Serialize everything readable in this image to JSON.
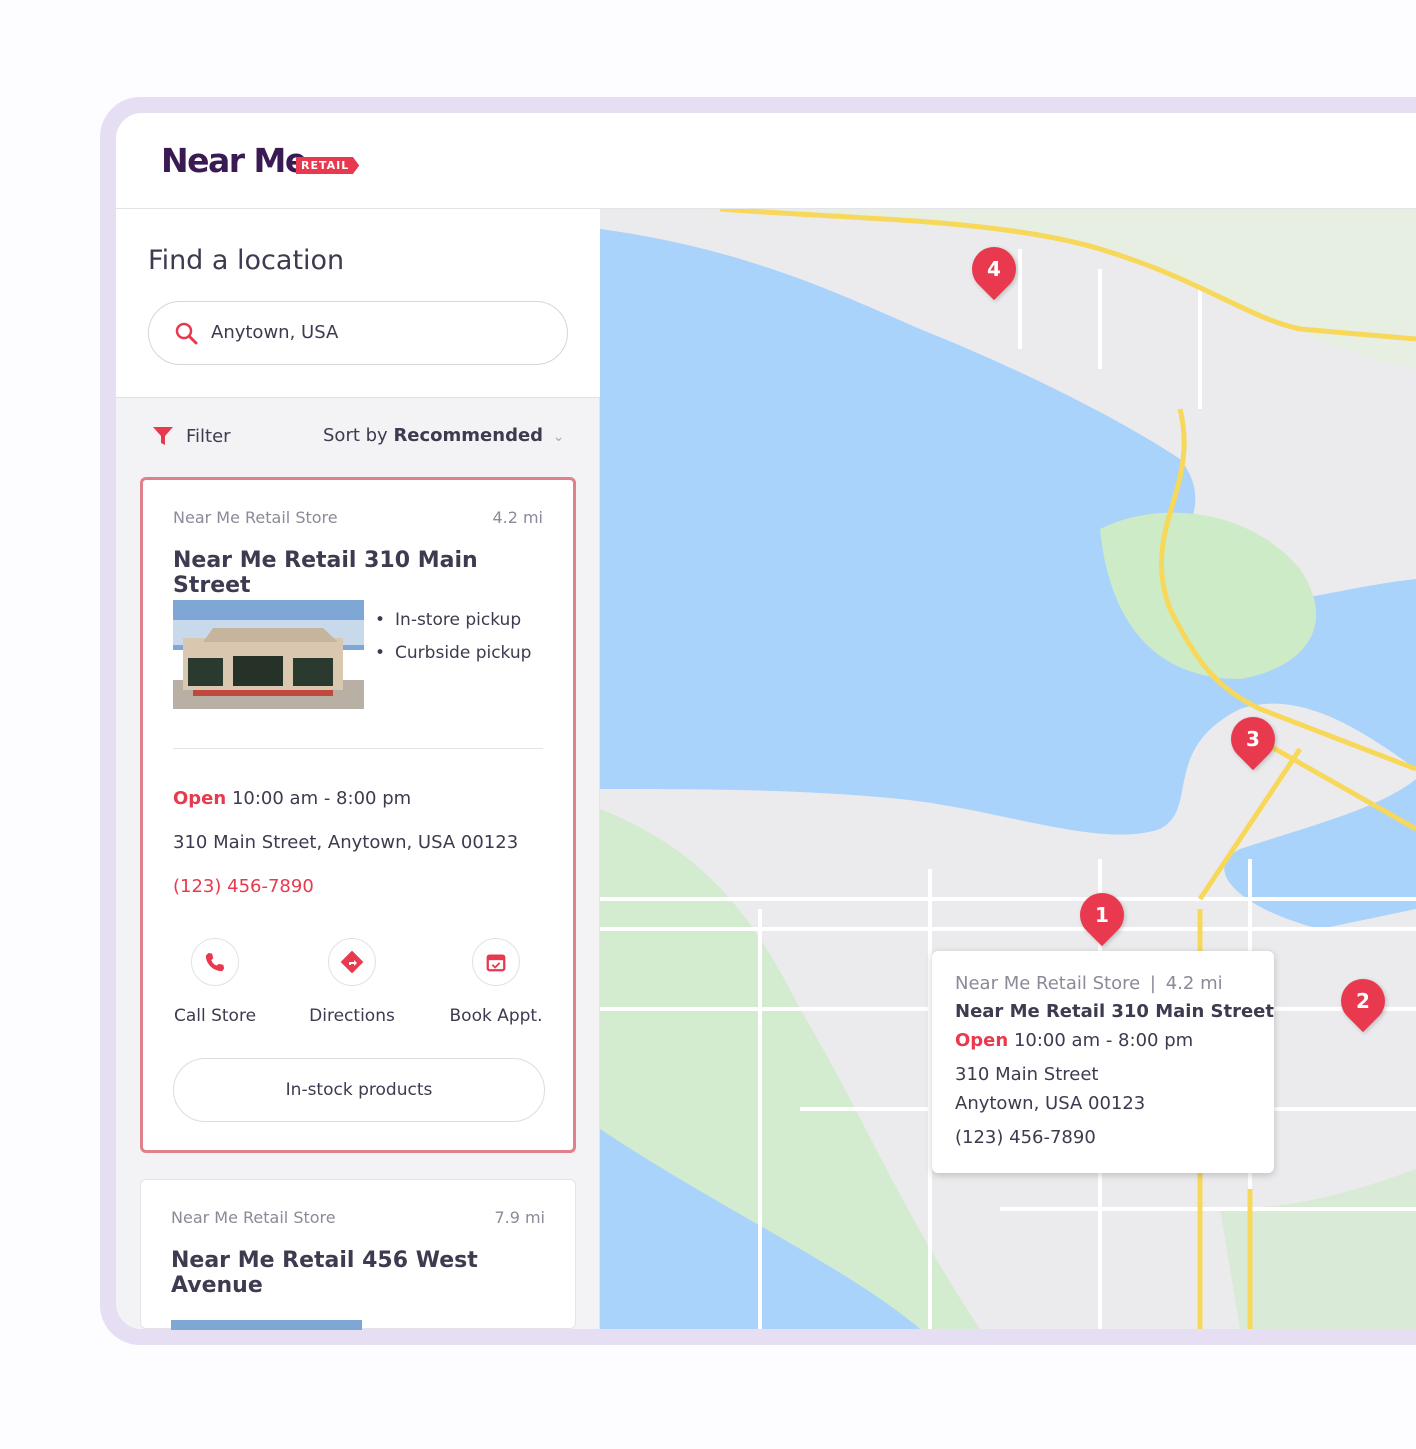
{
  "brand": {
    "name": "Near Me",
    "badge": "RETAIL",
    "accent": "#e8394e",
    "primary": "#3a1a52"
  },
  "search": {
    "title": "Find a location",
    "value": "Anytown, USA",
    "icon": "search-icon"
  },
  "toolbar": {
    "filter_label": "Filter",
    "sort_prefix": "Sort by",
    "sort_value": "Recommended"
  },
  "stores": [
    {
      "category": "Near Me Retail Store",
      "distance": "4.2 mi",
      "name": "Near Me Retail 310 Main Street",
      "features": [
        "In-store pickup",
        "Curbside pickup"
      ],
      "status": "Open",
      "hours": "10:00 am - 8:00 pm",
      "address": "310 Main Street, Anytown, USA 00123",
      "phone": "(123) 456-7890",
      "actions": [
        "Call Store",
        "Directions",
        "Book Appt."
      ],
      "instock_label": "In-stock products"
    },
    {
      "category": "Near Me Retail Store",
      "distance": "7.9 mi",
      "name": "Near Me Retail 456 West Avenue"
    }
  ],
  "map": {
    "pins": [
      "4",
      "3",
      "1",
      "2"
    ],
    "colors": {
      "water": "#aad3fb",
      "land": "#ebebed",
      "park": "#cdebc7",
      "road": "#f7d85a"
    },
    "popup": {
      "category": "Near Me Retail Store",
      "separator": "|",
      "distance": "4.2 mi",
      "name": "Near Me Retail 310 Main Street",
      "status": "Open",
      "hours": "10:00 am - 8:00 pm",
      "street": "310 Main Street",
      "city": "Anytown, USA 00123",
      "phone": "(123) 456-7890"
    }
  }
}
